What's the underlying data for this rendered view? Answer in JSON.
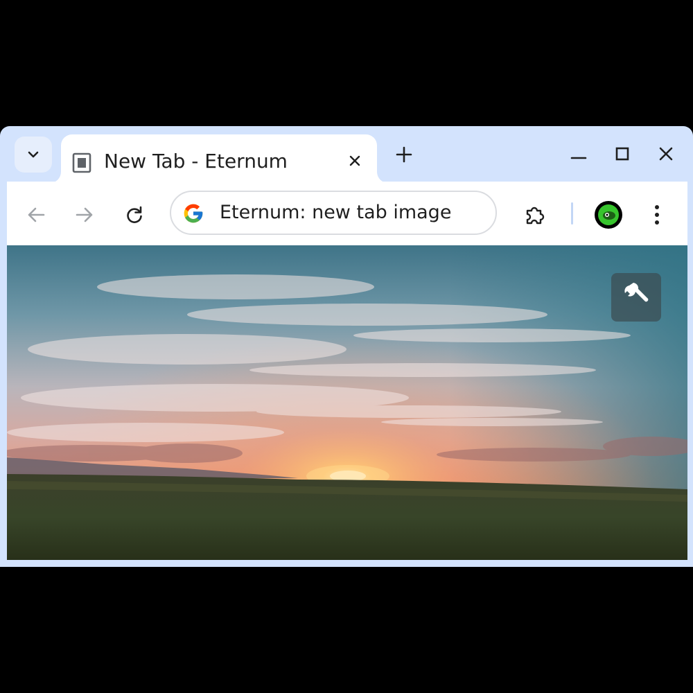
{
  "tab": {
    "title": "New Tab - Eternum"
  },
  "omnibox": {
    "text": "Eternum: new tab image"
  },
  "icons": {
    "tab_search": "chevron-down-icon",
    "favicon": "document-icon",
    "tab_close": "close-icon",
    "new_tab": "plus-icon",
    "minimize": "minimize-icon",
    "maximize": "maximize-icon",
    "close_window": "close-icon",
    "back": "arrow-left-icon",
    "forward": "arrow-right-icon",
    "reload": "reload-icon",
    "search_engine": "google-g-icon",
    "extensions": "puzzle-icon",
    "profile": "avatar",
    "menu": "three-dots-vertical-icon",
    "settings": "wrench-icon"
  },
  "colors": {
    "frame": "#d3e3fd",
    "tab_active": "#ffffff",
    "toolbar": "#ffffff",
    "avatar_ring": "#000000",
    "avatar_fill": "#37c52d",
    "settings_button": "#3c4c52"
  }
}
